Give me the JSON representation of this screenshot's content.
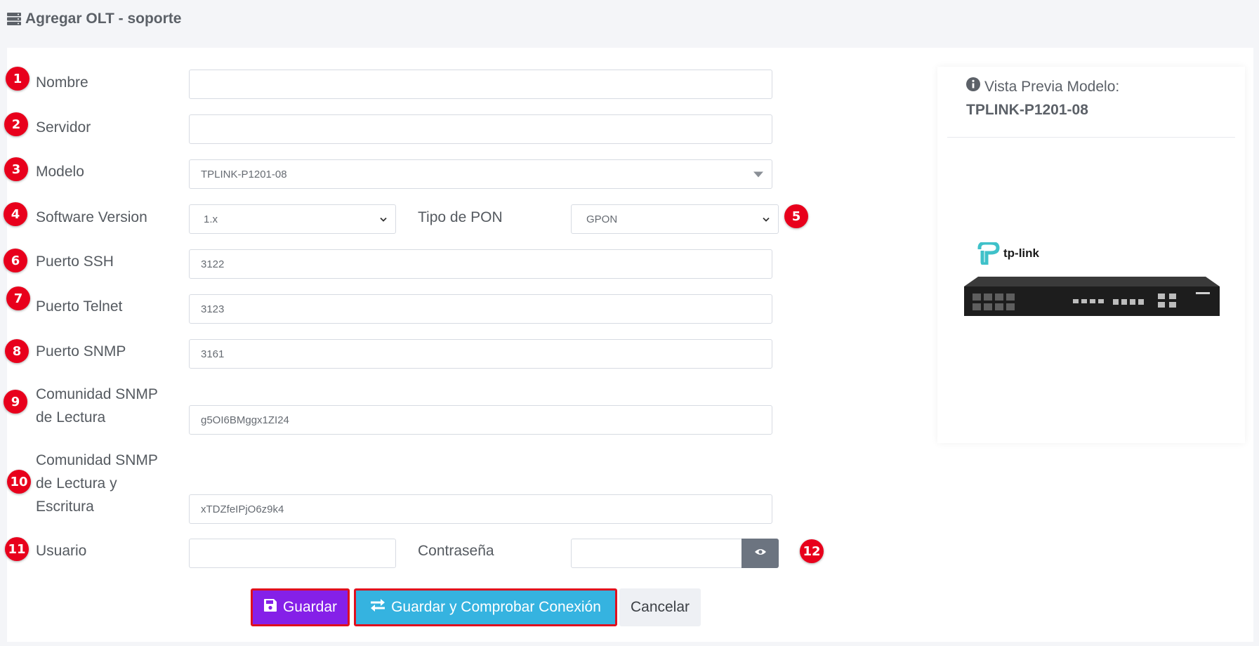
{
  "header": {
    "title": "Agregar OLT - soporte",
    "icon": "server-icon"
  },
  "form": {
    "nombre": {
      "badge": "1",
      "label": "Nombre",
      "value": ""
    },
    "servidor": {
      "badge": "2",
      "label": "Servidor",
      "value": ""
    },
    "modelo": {
      "badge": "3",
      "label": "Modelo",
      "value": "TPLINK-P1201-08"
    },
    "software_version": {
      "badge": "4",
      "label": "Software Version",
      "value": "1.x"
    },
    "tipo_pon": {
      "badge": "5",
      "label": "Tipo de PON",
      "value": "GPON"
    },
    "puerto_ssh": {
      "badge": "6",
      "label": "Puerto SSH",
      "value": "3122"
    },
    "puerto_telnet": {
      "badge": "7",
      "label": "Puerto Telnet",
      "value": "3123"
    },
    "puerto_snmp": {
      "badge": "8",
      "label": "Puerto SNMP",
      "value": "3161"
    },
    "comunidad_lectura": {
      "badge": "9",
      "label_line1": "Comunidad SNMP",
      "label_line2": "de Lectura",
      "value": "g5OI6BMggx1ZI24"
    },
    "comunidad_escritura": {
      "badge": "10",
      "label_line1": "Comunidad SNMP",
      "label_line2": "de Lectura y",
      "label_line3": "Escritura",
      "value": "xTDZfeIPjO6z9k4"
    },
    "usuario": {
      "badge": "11",
      "label": "Usuario",
      "value": ""
    },
    "contrasena": {
      "badge": "12",
      "label": "Contraseña",
      "value": ""
    }
  },
  "buttons": {
    "save": "Guardar",
    "save_check": "Guardar y Comprobar Conexión",
    "cancel": "Cancelar"
  },
  "preview": {
    "title": "Vista Previa Modelo:",
    "model": "TPLINK-P1201-08",
    "brand": "tp-link"
  },
  "colors": {
    "badge": "#e8001c",
    "save_button": "#8520e8",
    "save_check_button": "#35b3e0",
    "highlight_border": "#e0101e"
  }
}
